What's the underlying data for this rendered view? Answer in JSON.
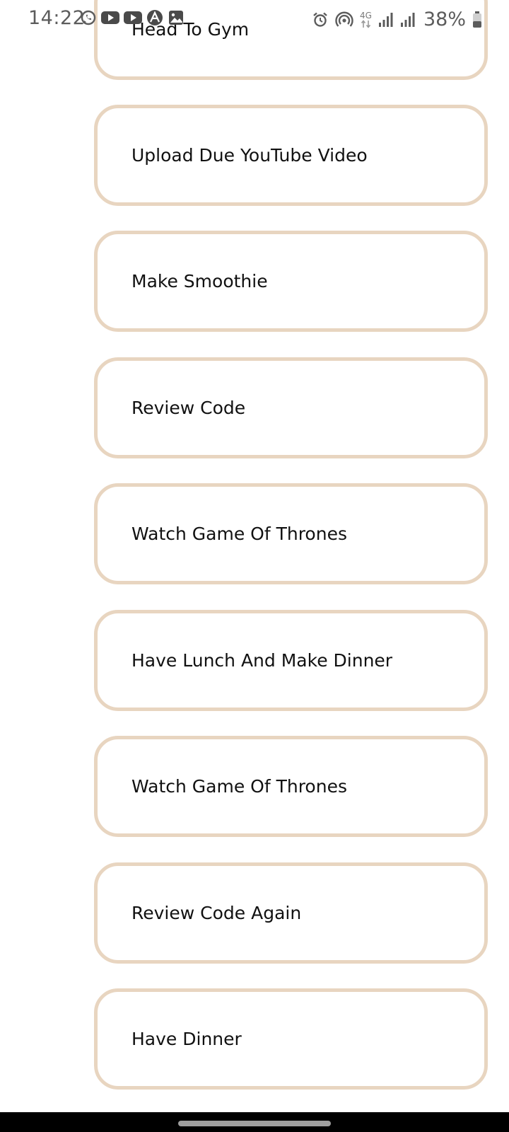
{
  "status_bar": {
    "time": "14:22",
    "battery_percent": "38%",
    "network_type": "4G",
    "notification_icons": [
      "whatsapp-icon",
      "youtube-icon",
      "youtube-icon",
      "app-icon",
      "gallery-icon"
    ],
    "system_icons": [
      "alarm-icon",
      "hotspot-icon",
      "network-4g-icon",
      "signal-icon",
      "signal-icon",
      "battery-icon"
    ]
  },
  "tasks": [
    {
      "label": "Head To Gym"
    },
    {
      "label": "Upload Due YouTube Video"
    },
    {
      "label": "Make Smoothie"
    },
    {
      "label": "Review Code"
    },
    {
      "label": "Watch Game Of Thrones"
    },
    {
      "label": "Have Lunch And Make Dinner"
    },
    {
      "label": "Watch Game Of Thrones"
    },
    {
      "label": "Review Code Again"
    },
    {
      "label": "Have Dinner"
    }
  ],
  "colors": {
    "card_border": "#e8d5c0",
    "background": "#ffffff",
    "text": "#111111",
    "nav_bar": "#000000"
  }
}
